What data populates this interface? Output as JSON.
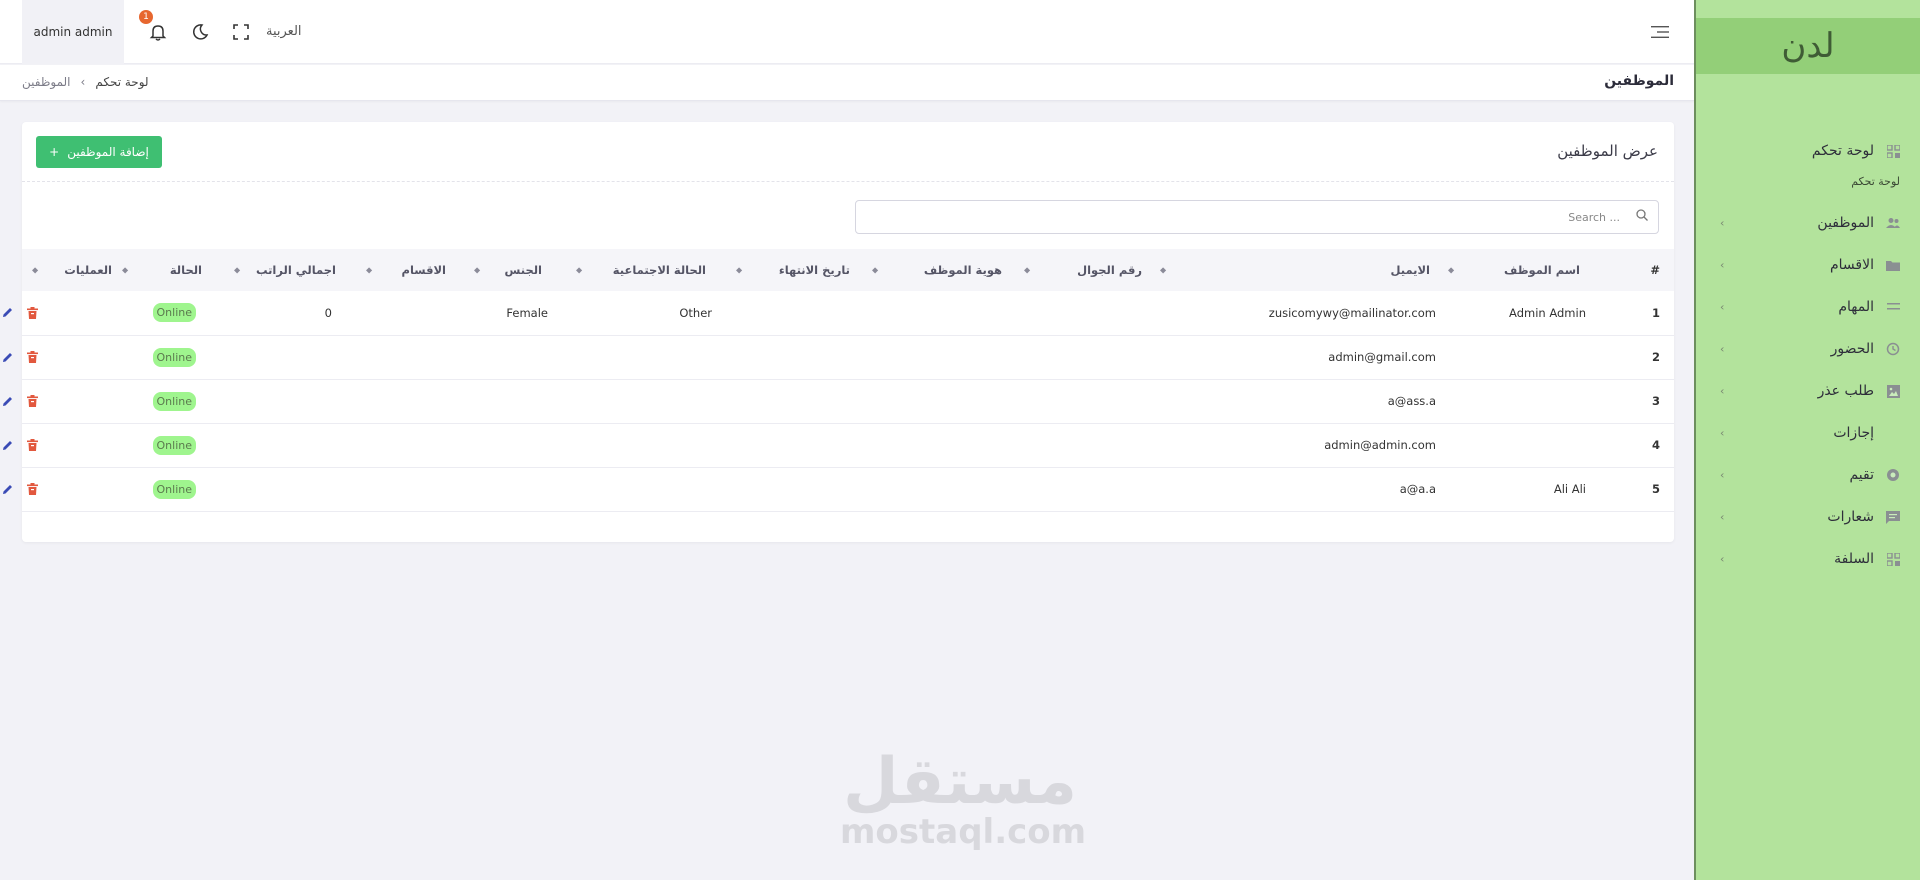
{
  "brand": {
    "name": "لدن"
  },
  "sidebar": {
    "items": [
      {
        "label": "لوحة تحكم",
        "icon": "grid-icon",
        "has_chevron": false
      },
      {
        "label": "الموظفين",
        "icon": "users-icon",
        "has_chevron": true
      },
      {
        "label": "الاقسام",
        "icon": "folder-icon",
        "has_chevron": true
      },
      {
        "label": "المهام",
        "icon": "list-icon",
        "has_chevron": true
      },
      {
        "label": "الحضور",
        "icon": "history-icon",
        "has_chevron": true
      },
      {
        "label": "طلب عذر",
        "icon": "image-icon",
        "has_chevron": true
      },
      {
        "label": "إجازات",
        "icon": "blank-icon",
        "has_chevron": true
      },
      {
        "label": "تقيم",
        "icon": "circle-icon",
        "has_chevron": true
      },
      {
        "label": "شعارات",
        "icon": "message-icon",
        "has_chevron": true
      },
      {
        "label": "السلفة",
        "icon": "grid-icon",
        "has_chevron": true
      }
    ],
    "sub_label": "لوحة تحكم"
  },
  "header": {
    "user": "admin admin",
    "notification_count": "1",
    "language": "العربية"
  },
  "subheader": {
    "page_title": "الموظفين",
    "breadcrumb": [
      "لوحة تحكم",
      "الموظفين"
    ]
  },
  "card": {
    "title": "عرض الموظفين",
    "add_button": "إضافة الموظفين",
    "search_placeholder": "Search ..."
  },
  "table": {
    "columns": [
      "#",
      "اسم الموظف",
      "الايميل",
      "رقم الجوال",
      "هوية الموظف",
      "تاريخ الانتهاء",
      "الحالة الاجتماعية",
      "الجنس",
      "الاقسام",
      "اجمالي الراتب",
      "الحالة",
      "العمليات"
    ],
    "rows": [
      {
        "num": "1",
        "name": "Admin Admin",
        "email": "zusicomywy@mailinator.com",
        "phone": "",
        "id": "",
        "expiry": "",
        "marital": "Other",
        "gender": "Female",
        "dept": "",
        "salary": "0",
        "status": "Online"
      },
      {
        "num": "2",
        "name": "",
        "email": "admin@gmail.com",
        "phone": "",
        "id": "",
        "expiry": "",
        "marital": "",
        "gender": "",
        "dept": "",
        "salary": "",
        "status": "Online"
      },
      {
        "num": "3",
        "name": "",
        "email": "a@ass.a",
        "phone": "",
        "id": "",
        "expiry": "",
        "marital": "",
        "gender": "",
        "dept": "",
        "salary": "",
        "status": "Online"
      },
      {
        "num": "4",
        "name": "",
        "email": "admin@admin.com",
        "phone": "",
        "id": "",
        "expiry": "",
        "marital": "",
        "gender": "",
        "dept": "",
        "salary": "",
        "status": "Online"
      },
      {
        "num": "5",
        "name": "Ali Ali",
        "email": "a@a.a",
        "phone": "",
        "id": "",
        "expiry": "",
        "marital": "",
        "gender": "",
        "dept": "",
        "salary": "",
        "status": "Online"
      }
    ]
  },
  "watermark": {
    "arabic": "مستقل",
    "latin": "mostaql.com"
  },
  "colors": {
    "sidebar_bg": "#b3e39c",
    "brand_bg": "#93cf78",
    "primary": "#3fbf72",
    "status_bg": "#9ff58e",
    "badge": "#e7672f",
    "delete": "#e2583e",
    "edit": "#3a4bb5",
    "view": "#3fbf72"
  }
}
